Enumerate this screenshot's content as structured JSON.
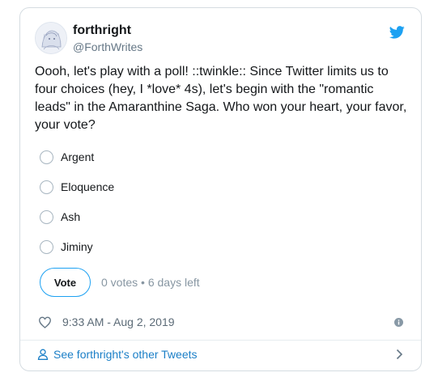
{
  "user": {
    "display_name": "forthright",
    "handle": "@ForthWrites"
  },
  "tweet": {
    "text": "Oooh, let's play with a poll! ::twinkle:: Since Twitter limits us to four choices (hey, I *love* 4s), let's begin with the \"romantic leads\" in the Amaranthine Saga. Who won your heart, your favor, your vote?"
  },
  "poll": {
    "options": [
      {
        "label": "Argent"
      },
      {
        "label": "Eloquence"
      },
      {
        "label": "Ash"
      },
      {
        "label": "Jiminy"
      }
    ],
    "vote_label": "Vote",
    "status": "0 votes • 6 days left"
  },
  "meta": {
    "timestamp": "9:33 AM - Aug 2, 2019"
  },
  "footer": {
    "link_text": "See forthright's other Tweets"
  },
  "icons": {
    "brand": "twitter-bird-icon",
    "like": "heart-icon",
    "info": "info-icon",
    "profile": "person-icon",
    "chevron": "chevron-right-icon"
  },
  "colors": {
    "brand": "#1da1f2",
    "link": "#1b7fc7",
    "muted": "#657786",
    "border": "#d5dce1"
  }
}
